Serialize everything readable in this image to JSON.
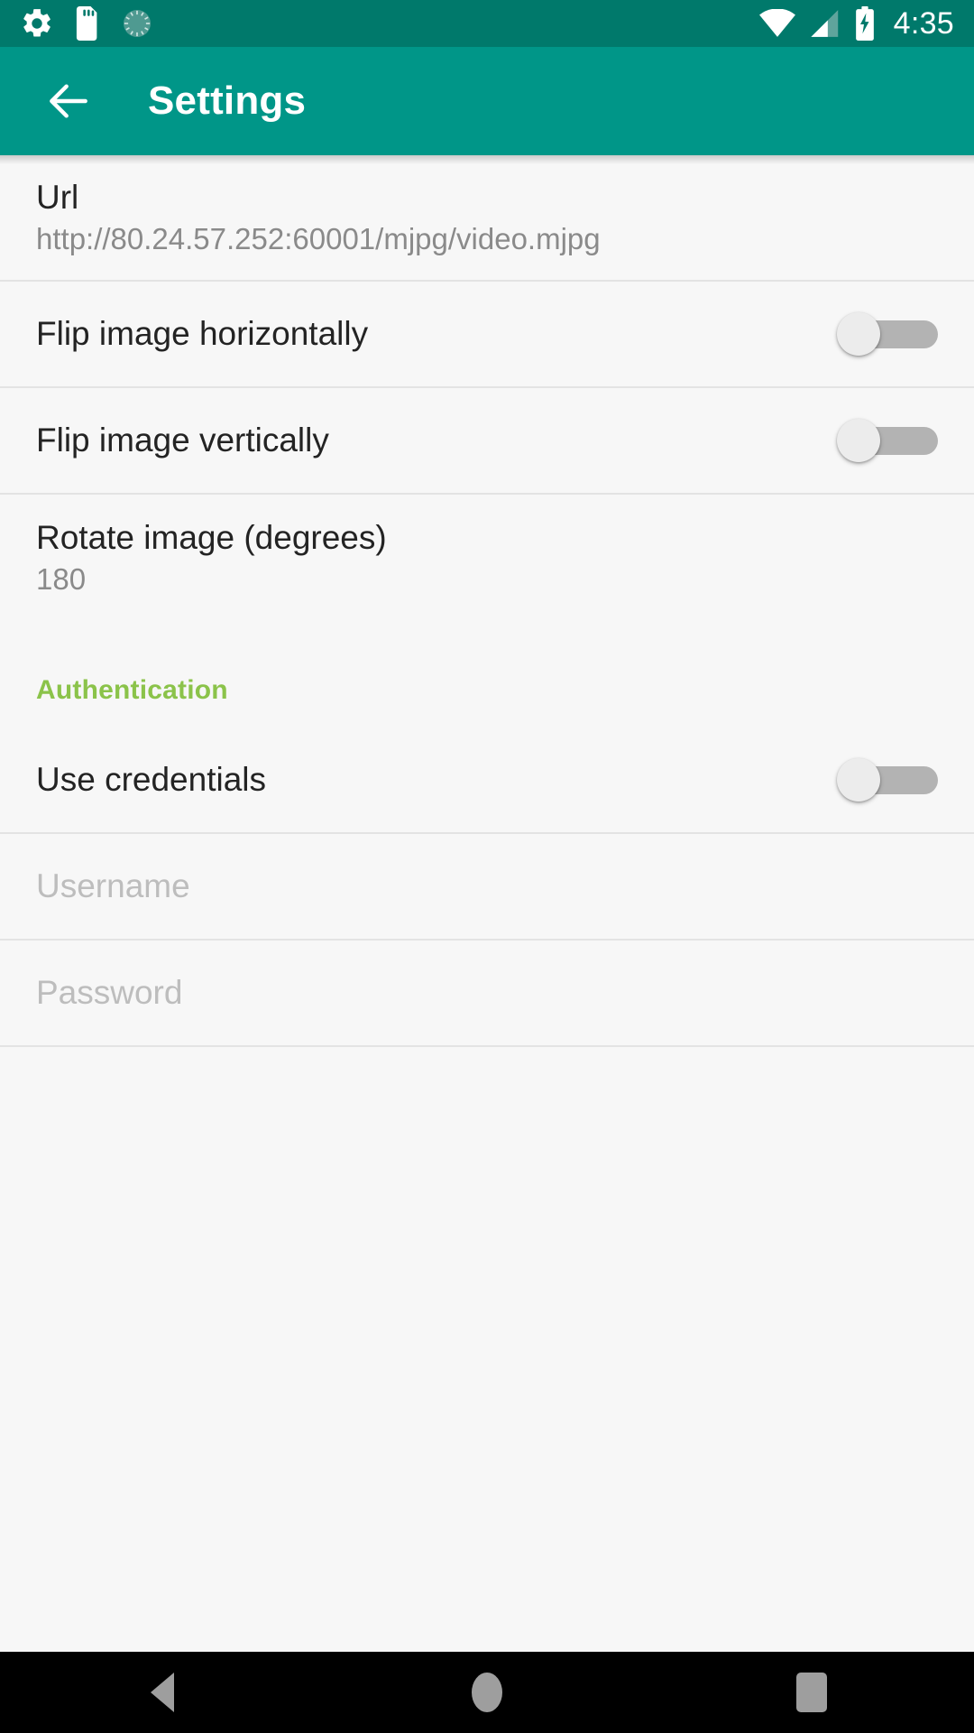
{
  "status_bar": {
    "icons_left": [
      "gear-icon",
      "sd-card-icon",
      "circular-progress-icon"
    ],
    "icons_right": [
      "wifi-icon",
      "cell-signal-icon",
      "battery-charging-icon"
    ],
    "time": "4:35",
    "background_color": "#00796b"
  },
  "app_bar": {
    "back_icon": "arrow-back-icon",
    "title": "Settings",
    "background_color": "#009688"
  },
  "settings": {
    "url": {
      "title": "Url",
      "value": "http://80.24.57.252:60001/mjpg/video.mjpg"
    },
    "flip_horizontal": {
      "title": "Flip image horizontally",
      "state": "off"
    },
    "flip_vertical": {
      "title": "Flip image vertically",
      "state": "off"
    },
    "rotate": {
      "title": "Rotate image (degrees)",
      "value": "180"
    }
  },
  "authentication": {
    "header": "Authentication",
    "header_color": "#8bc34a",
    "use_credentials": {
      "title": "Use credentials",
      "state": "off"
    },
    "username": {
      "placeholder": "Username",
      "value": ""
    },
    "password": {
      "placeholder": "Password",
      "value": ""
    }
  },
  "nav_bar": {
    "back_label": "back-button",
    "home_label": "home-button",
    "recents_label": "recents-button"
  }
}
